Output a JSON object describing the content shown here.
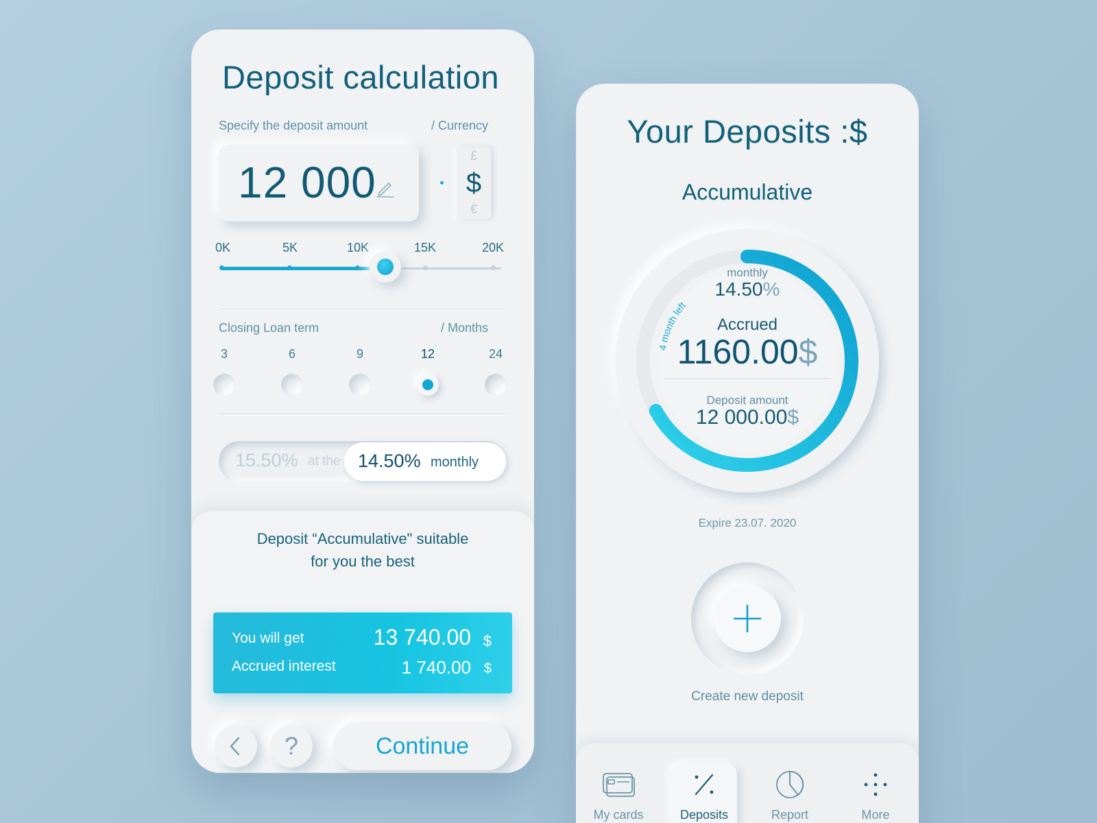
{
  "calc": {
    "title": "Deposit calculation",
    "amount_label": "Specify the deposit amount",
    "currency_label": "/  Currency",
    "amount_value": "12 000",
    "currencies": {
      "top": "£",
      "selected": "$",
      "bottom": "€"
    },
    "slider": {
      "ticks": [
        "0K",
        "5K",
        "10K",
        "15K",
        "20K"
      ],
      "value_fraction": 0.58
    },
    "term_label": "Closing Loan term",
    "term_unit": "/  Months",
    "terms": [
      "3",
      "6",
      "9",
      "12",
      "24"
    ],
    "selected_term": "12",
    "rate_inactive": "15.50%",
    "rate_inactive_suffix": "at the",
    "rate_active": "14.50%",
    "rate_active_suffix": "monthly",
    "suggestion_line1": "Deposit “Accumulative\" suitable",
    "suggestion_line2": "for you the best",
    "you_will_get_label": "You will get",
    "you_will_get_value": "13 740.00",
    "accrued_interest_label": "Accrued interest",
    "accrued_interest_value": "1 740.00",
    "dollar": "$",
    "back_icon": "chevron-left-icon",
    "help_label": "?",
    "continue_label": "Continue"
  },
  "deposits": {
    "title": "Your Deposits :$",
    "deposit_name": "Accumulative",
    "ring_progress_fraction": 0.67,
    "ring_note": "4 month left",
    "monthly_label": "monthly",
    "monthly_rate": "14.50",
    "percent": "%",
    "accrued_label": "Accrued",
    "accrued_value": "1160.00",
    "dollar": "$",
    "deposit_amount_label": "Deposit amount",
    "deposit_amount_value": "12 000.00",
    "expire": "Expire 23.07. 2020",
    "create_label": "Create new deposit"
  },
  "nav": {
    "items": [
      {
        "label": "My cards",
        "icon": "card-icon"
      },
      {
        "label": "Deposits",
        "icon": "percent-icon",
        "active": true
      },
      {
        "label": "Report",
        "icon": "pie-chart-icon"
      },
      {
        "label": "More",
        "icon": "dots-icon"
      }
    ]
  },
  "colors": {
    "accent": "#12a8d2",
    "text": "#12607a",
    "card": "#f0f2f4",
    "background": "#aecbdd"
  }
}
